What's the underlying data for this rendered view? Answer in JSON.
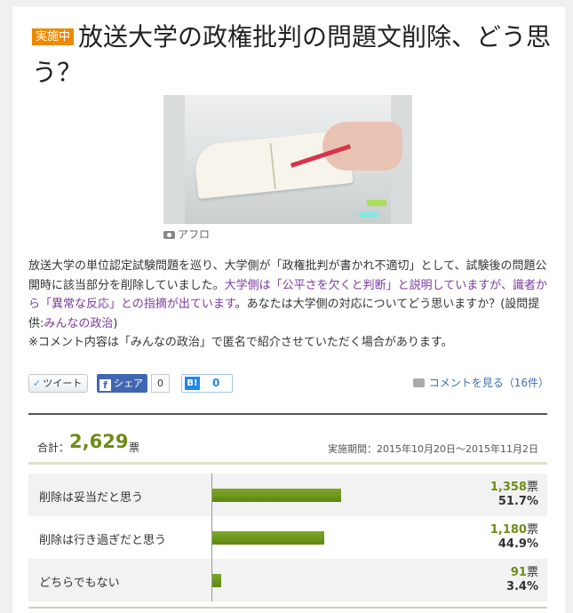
{
  "header": {
    "badge": "実施中",
    "title": "放送大学の政権批判の問題文削除、どう思う？"
  },
  "photo": {
    "caption": "アフロ",
    "caption_icon": "camera-icon"
  },
  "description": {
    "part1": "放送大学の単位認定試験問題を巡り、大学側が「政権批判が書かれ不適切」として、試験後の問題公開時に該当部分を削除していました。",
    "highlight1": "大学側は「公平さを欠くと判断」と説明していますが、識者から「異常な反応」との指摘が出ています",
    "part2": "。あなたは大学側の対応についてどう思いますか？(設問提供:",
    "link": "みんなの政治",
    "part3": ")",
    "note": "※コメント内容は「みんなの政治」で匿名で紹介させていただく場合があります。"
  },
  "social": {
    "tweet_label": "ツイート",
    "share_label": "シェア",
    "share_count": "0",
    "hatena_label": "B!",
    "hatena_count": "0",
    "comment_link": "コメントを見る（16件）"
  },
  "results": {
    "total_label": "合計：",
    "total_value": "2,629",
    "total_unit": "票",
    "period": "実施期間：2015年10月20日～2015年11月2日"
  },
  "chart_data": {
    "type": "bar",
    "orientation": "horizontal",
    "categories": [
      "削除は妥当だと思う",
      "削除は行き過ぎだと思う",
      "どちらでもない"
    ],
    "values": [
      1358,
      1180,
      91
    ],
    "vote_labels": [
      "1,358",
      "1,180",
      "91"
    ],
    "vote_unit": "票",
    "percent_labels": [
      "51.7%",
      "44.9%",
      "3.4%"
    ],
    "percents": [
      51.7,
      44.9,
      3.4
    ],
    "bar_color": "#6d9420"
  },
  "colors": {
    "badge": "#ec8a00",
    "accent": "#6d8c16",
    "highlight": "#7b3aa0",
    "link": "#3a6fb5"
  }
}
